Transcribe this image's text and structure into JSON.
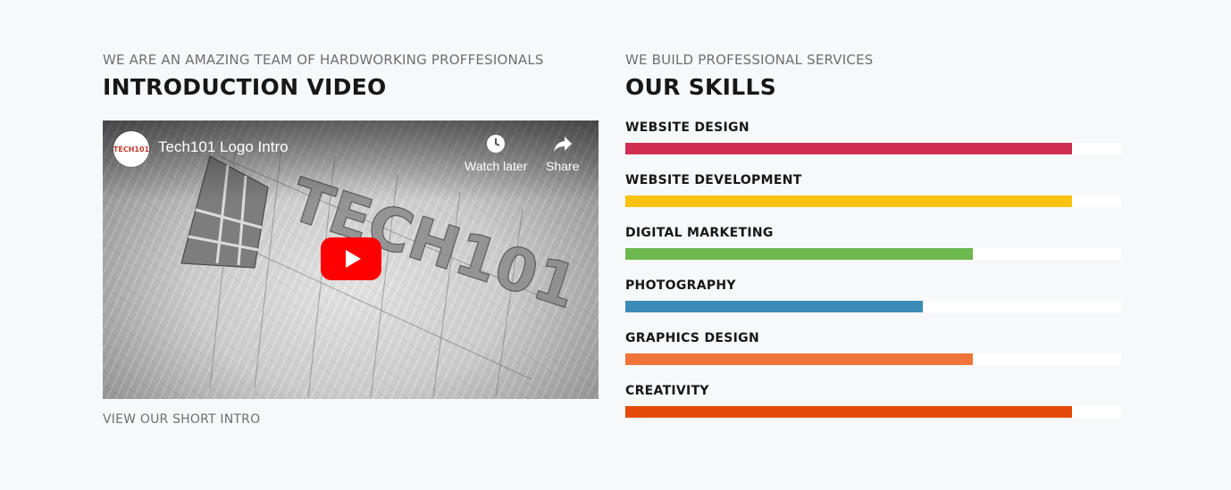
{
  "intro": {
    "eyebrow": "WE ARE AN AMAZING TEAM OF HARDWORKING PROFFESIONALS",
    "heading": "INTRODUCTION VIDEO",
    "caption": "VIEW OUR SHORT INTRO",
    "video": {
      "channel_logo_text": "TECH101",
      "title": "Tech101 Logo Intro",
      "watch_later_label": "Watch later",
      "share_label": "Share",
      "play_icon": "play-icon",
      "watch_later_icon": "clock-icon",
      "share_icon": "share-arrow-icon",
      "artwork_text": "TECH101"
    }
  },
  "skills_section": {
    "eyebrow": "WE BUILD PROFESSIONAL SERVICES",
    "heading": "OUR SKILLS",
    "skills": [
      {
        "label": "WEBSITE DESIGN",
        "percent": 90,
        "color": "#d12f52"
      },
      {
        "label": "WEBSITE DEVELOPMENT",
        "percent": 90,
        "color": "#f8c20f"
      },
      {
        "label": "DIGITAL MARKETING",
        "percent": 70,
        "color": "#6bb84f"
      },
      {
        "label": "PHOTOGRAPHY",
        "percent": 60,
        "color": "#3c8bb8"
      },
      {
        "label": "GRAPHICS DESIGN",
        "percent": 70,
        "color": "#ef7438"
      },
      {
        "label": "CREATIVITY",
        "percent": 90,
        "color": "#e64a0b"
      }
    ]
  },
  "colors": {
    "background": "#f7f8fa",
    "track": "#ffffff",
    "play_button": "#ff0000"
  }
}
